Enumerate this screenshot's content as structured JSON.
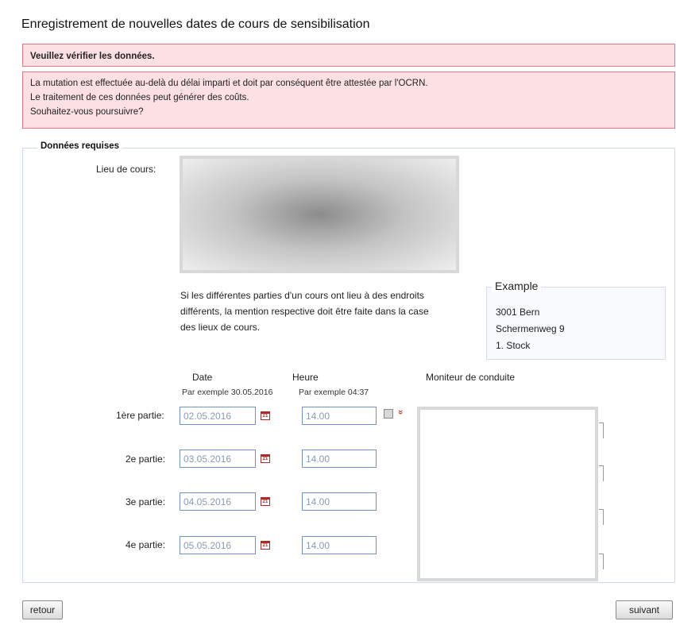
{
  "page": {
    "title": "Enregistrement de nouvelles dates de cours de sensibilisation"
  },
  "alert": {
    "heading": "Veuillez vérifier les données.",
    "lines": [
      "La mutation est effectuée au-delà du délai imparti et doit par conséquent être attestée par l'OCRN.",
      "Le traitement de ces données peut générer des coûts.",
      "Souhaitez-vous poursuivre?"
    ]
  },
  "form": {
    "legend": "Données requises",
    "lieu_label": "Lieu de cours:",
    "hint_lines": [
      "Si les différentes parties d'un cours ont lieu à des endroits",
      "différents, la mention respective doit être faite dans la case",
      "des lieux de cours."
    ],
    "example": {
      "title": "Example",
      "lines": [
        "3001 Bern",
        "Schermenweg 9",
        "1. Stock"
      ]
    },
    "columns": {
      "date": "Date",
      "date_hint": "Par exemple 30.05.2016",
      "heure": "Heure",
      "heure_hint": "Par exemple 04:37",
      "moniteur": "Moniteur de conduite"
    },
    "rows": [
      {
        "label": "1ère partie:",
        "date": "02.05.2016",
        "heure": "14.00"
      },
      {
        "label": "2e partie:",
        "date": "03.05.2016",
        "heure": "14.00"
      },
      {
        "label": "3e partie:",
        "date": "04.05.2016",
        "heure": "14.00"
      },
      {
        "label": "4e partie:",
        "date": "05.05.2016",
        "heure": "14.00"
      }
    ],
    "calendar_icon_text": "21",
    "copy_down_glyph": "»"
  },
  "buttons": {
    "back": "retour",
    "next": "suivant"
  },
  "colors": {
    "alert_bg": "#fde0e4",
    "alert_border": "#e07a86",
    "input_border": "#6f93c4",
    "calendar_red": "#b02a2a"
  }
}
